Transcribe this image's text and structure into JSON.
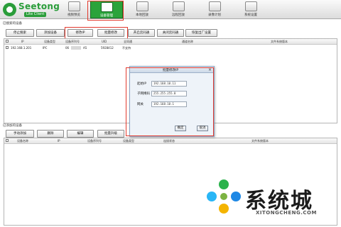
{
  "app": {
    "brand": "Seetong",
    "sub": "Lite Client"
  },
  "nav": [
    {
      "label": "视频预览",
      "active": false
    },
    {
      "label": "设备管理",
      "active": true
    },
    {
      "label": "本地回放",
      "active": false
    },
    {
      "label": "远程回放",
      "active": false
    },
    {
      "label": "录像计划",
      "active": false
    },
    {
      "label": "系统设置",
      "active": false
    }
  ],
  "found": {
    "title": "已搜索的设备",
    "buttons": [
      "停止搜索",
      "添加设备",
      "修改IP",
      "批量修改",
      "开启云同通",
      "关闭云同通",
      "恢复出厂设置"
    ],
    "headers": [
      "IP",
      "设备类型",
      "设备序列号",
      "UID",
      "全同通",
      "通道名称",
      "文件系统版本"
    ],
    "rows": [
      {
        "ip": "192.168.1.201",
        "type": "IPC",
        "serial_a": "06",
        "serial_b": "A5",
        "uid": "5928412",
        "cloud": "不支持"
      }
    ]
  },
  "added": {
    "title": "已添加的设备",
    "buttons": [
      "手动添加",
      "删除",
      "编辑",
      "批量升级"
    ],
    "headers": [
      "设备名称",
      "IP",
      "设备序列号",
      "设备类型",
      "连接状态",
      "文件系统版本"
    ]
  },
  "dialog": {
    "title": "批量修改IP",
    "close": "×",
    "fields": [
      {
        "label": "起始IP",
        "value": "192.168.10.11"
      },
      {
        "label": "子网掩码",
        "value": "255.255.255.0"
      },
      {
        "label": "网关",
        "value": "192.168.10.1"
      }
    ],
    "ok": "确定",
    "cancel": "取消"
  },
  "watermark": {
    "text": "系统城",
    "url": "XITONGCHENG.COM"
  },
  "colors": {
    "accent": "#2aa33a",
    "highlight": "#e23a2e"
  }
}
